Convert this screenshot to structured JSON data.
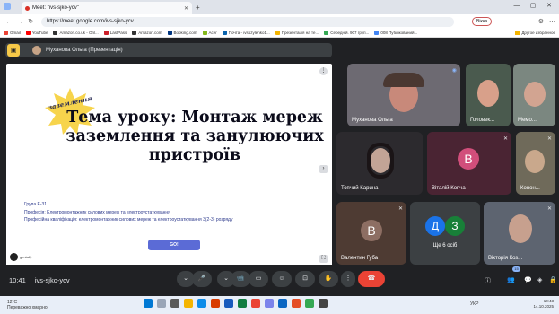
{
  "browser": {
    "tab_title": "Meet: \"ivs-sjko-ycv\"",
    "tab_close": "✕",
    "new_tab": "+",
    "url": "https://meet.google.com/ivs-sjko-ycv",
    "profile": "Вікна",
    "window_min": "—",
    "window_max": "▢",
    "window_close": "✕",
    "back": "←",
    "forward": "→",
    "reload": "↻"
  },
  "bookmarks": {
    "items": [
      {
        "label": "Gmail",
        "color": "#ea4335"
      },
      {
        "label": "YouTube",
        "color": "#ff0000"
      },
      {
        "label": "Amazon.co.uk - Onl...",
        "color": "#333333"
      },
      {
        "label": "LastPass",
        "color": "#cc2029"
      },
      {
        "label": "Amazon.com",
        "color": "#333333"
      },
      {
        "label": "Booking.com",
        "color": "#003580"
      },
      {
        "label": "Acer",
        "color": "#83b81a"
      },
      {
        "label": "Почта - ivsozylenko1...",
        "color": "#0a64ad"
      },
      {
        "label": "Презентація на те...",
        "color": "#f4b400"
      },
      {
        "label": "Середній. 907 груп...",
        "color": "#34a853"
      },
      {
        "label": "008 Публікований...",
        "color": "#4285f4"
      }
    ],
    "other": "Другое избранное"
  },
  "meet": {
    "presenter_label": "Муханова Ольга (Презентація)",
    "slide": {
      "burst_text": "заземлення",
      "title": "Тема уроку: Монтаж мереж заземлення та занулюючих пристроїв",
      "info": [
        "Група Е-31",
        "Професія: Електромонтажник силових мереж та електроустаткування",
        "Професійна кваліфікація: електромонтажник силових мереж та електроустаткування 3(2-3) розряду"
      ],
      "button": "GO!",
      "brand": "genially",
      "more": "⋮",
      "next": "›",
      "fullscreen": "⛶"
    },
    "tiles": [
      {
        "name": "Муханова Ольга"
      },
      {
        "name": "Головек..."
      },
      {
        "name": "Мемо..."
      },
      {
        "name": "Топчий Карина"
      },
      {
        "name": "Віталій Копча",
        "initial": "В"
      },
      {
        "name": "Конон..."
      },
      {
        "name": "Валентин Губа",
        "initial": "В"
      },
      {
        "name": "Ще 6 осіб",
        "initial_1": "Д",
        "initial_2": "З"
      },
      {
        "name": "Вікторія Коз..."
      }
    ],
    "mic_off_glyph": "🎙",
    "accent_colors": {
      "vitaly": "#d14e7b",
      "valentyn": "#8d6e63",
      "more1": "#1a73e8",
      "more2": "#188038",
      "end_call": "#ea4335"
    }
  },
  "bottom_bar": {
    "time": "10:41",
    "meeting_code": "ivs-sjko-ycv",
    "buttons": [
      "⌄",
      "🎤",
      "⌄",
      "📹",
      "▭",
      "☺",
      "⊡",
      "✋",
      "⋮",
      "☎"
    ],
    "participants_count": "15",
    "right_icons": [
      "ⓘ",
      "👥",
      "💬",
      "◈",
      "🔒"
    ]
  },
  "taskbar": {
    "weather": "12°C",
    "weather_desc": "Переважно хмарно",
    "lang": "УКР",
    "clock_time": "10:43",
    "clock_date": "14.10.2025"
  }
}
